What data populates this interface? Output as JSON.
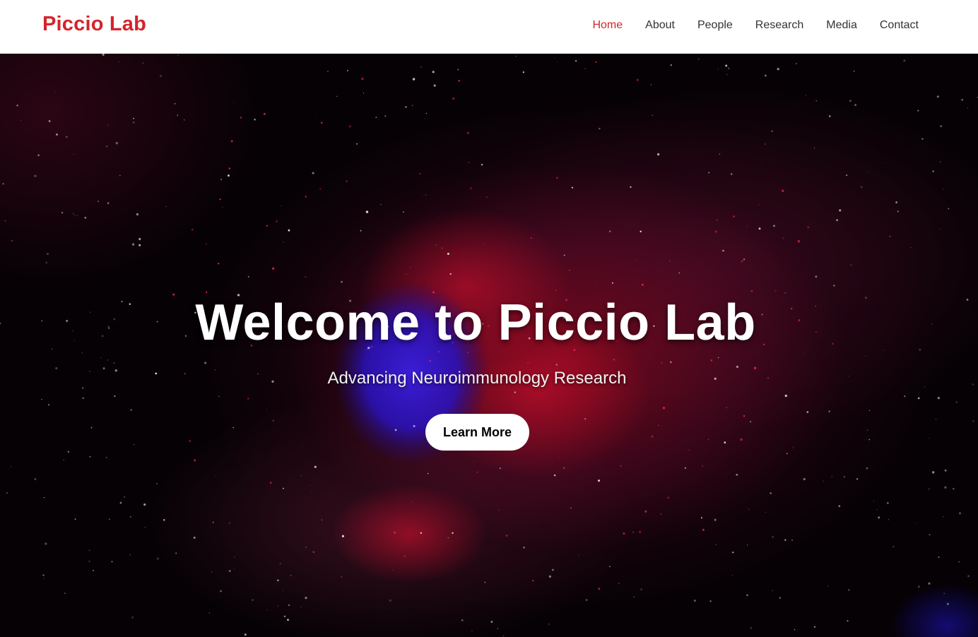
{
  "nav": {
    "brand": "Piccio Lab",
    "links": [
      {
        "label": "Home",
        "active": true
      },
      {
        "label": "About",
        "active": false
      },
      {
        "label": "People",
        "active": false
      },
      {
        "label": "Research",
        "active": false
      },
      {
        "label": "Media",
        "active": false
      },
      {
        "label": "Contact",
        "active": false
      }
    ]
  },
  "hero": {
    "title": "Welcome to Piccio Lab",
    "subtitle": "Advancing Neuroimmunology Research",
    "button_label": "Learn More",
    "background_image": "fluorescence-microscopy-cell"
  },
  "colors": {
    "accent": "#d4242c",
    "nav_text": "#333333",
    "nav_bg": "#ffffff",
    "hero_title": "#ffffff",
    "button_bg": "#ffffff",
    "button_text": "#000000"
  }
}
